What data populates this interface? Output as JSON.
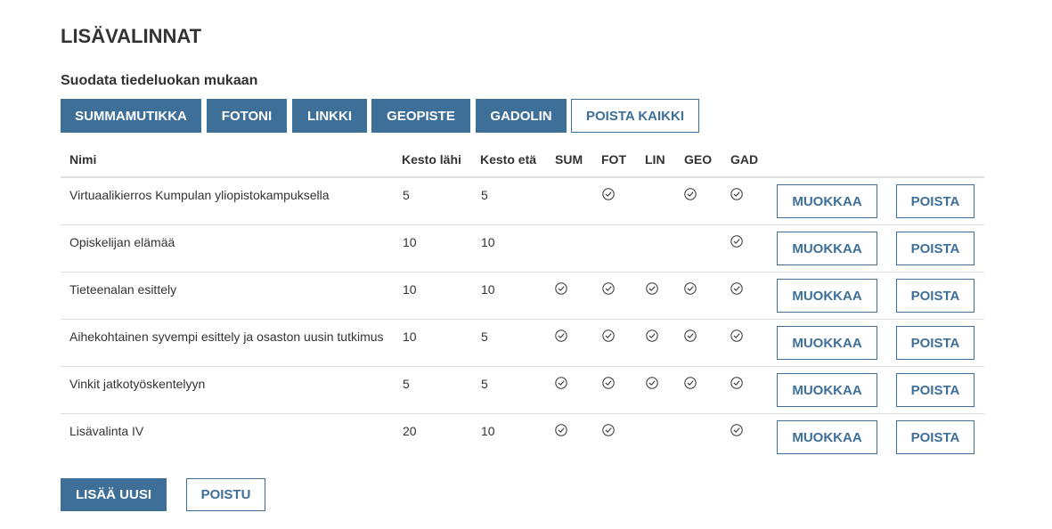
{
  "page": {
    "title": "LISÄVALINNAT",
    "filter_label": "Suodata tiedeluokan mukaan"
  },
  "filters": [
    {
      "label": "SUMMAMUTIKKA",
      "style": "solid"
    },
    {
      "label": "FOTONI",
      "style": "solid"
    },
    {
      "label": "LINKKI",
      "style": "solid"
    },
    {
      "label": "GEOPISTE",
      "style": "solid"
    },
    {
      "label": "GADOLIN",
      "style": "solid"
    },
    {
      "label": "POISTA KAIKKI",
      "style": "outline"
    }
  ],
  "table": {
    "headers": {
      "name": "Nimi",
      "near": "Kesto lähi",
      "far": "Kesto etä",
      "sum": "SUM",
      "fot": "FOT",
      "lin": "LIN",
      "geo": "GEO",
      "gad": "GAD"
    },
    "rows": [
      {
        "name": "Virtuaalikierros Kumpulan yliopistokampuksella",
        "near": "5",
        "far": "5",
        "sum": false,
        "fot": true,
        "lin": false,
        "geo": true,
        "gad": true
      },
      {
        "name": "Opiskelijan elämää",
        "near": "10",
        "far": "10",
        "sum": false,
        "fot": false,
        "lin": false,
        "geo": false,
        "gad": true
      },
      {
        "name": "Tieteenalan esittely",
        "near": "10",
        "far": "10",
        "sum": true,
        "fot": true,
        "lin": true,
        "geo": true,
        "gad": true
      },
      {
        "name": "Aihekohtainen syvempi esittely ja osaston uusin tutkimus",
        "near": "10",
        "far": "5",
        "sum": true,
        "fot": true,
        "lin": true,
        "geo": true,
        "gad": true
      },
      {
        "name": "Vinkit jatkotyöskentelyyn",
        "near": "5",
        "far": "5",
        "sum": true,
        "fot": true,
        "lin": true,
        "geo": true,
        "gad": true
      },
      {
        "name": "Lisävalinta IV",
        "near": "20",
        "far": "10",
        "sum": true,
        "fot": true,
        "lin": false,
        "geo": false,
        "gad": true
      }
    ],
    "edit_label": "MUOKKAA",
    "delete_label": "POISTA"
  },
  "footer": {
    "add_label": "LISÄÄ UUSI",
    "exit_label": "POISTU"
  },
  "colors": {
    "accent": "#3d6f99",
    "text": "#333333",
    "divider": "#dddddd"
  },
  "icons": {
    "check": "check-circle-icon"
  }
}
